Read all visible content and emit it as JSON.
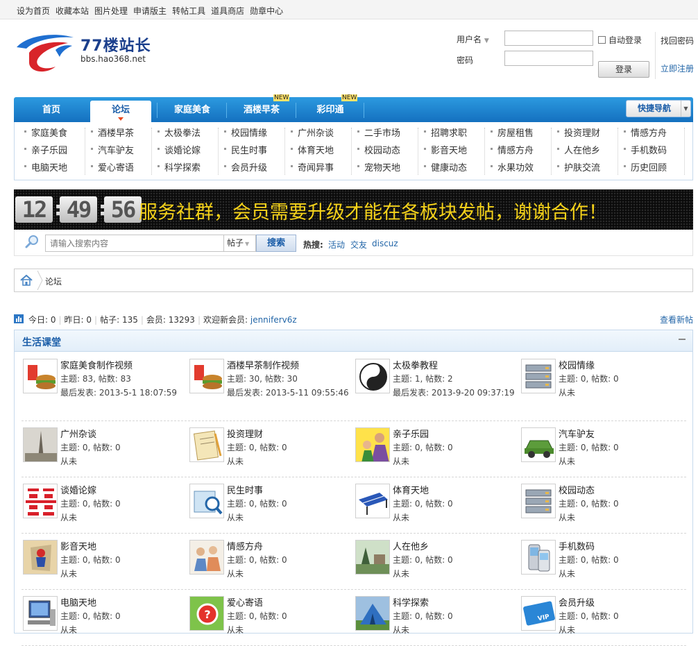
{
  "topbar": {
    "links": [
      "设为首页",
      "收藏本站",
      "图片处理",
      "申请版主",
      "转帖工具",
      "道具商店",
      "勋章中心"
    ]
  },
  "logo": {
    "brand": "77楼站长",
    "domain": "bbs.hao368.net"
  },
  "login": {
    "username_label": "用户名",
    "password_label": "密码",
    "auto_login": "自动登录",
    "login_button": "登录",
    "find_password": "找回密码",
    "register": "立即注册"
  },
  "nav": {
    "items": [
      {
        "label": "首页",
        "active": false
      },
      {
        "label": "论坛",
        "active": true
      },
      {
        "label": "家庭美食",
        "active": false
      },
      {
        "label": "酒楼早茶",
        "active": false,
        "badge": "NEW"
      },
      {
        "label": "彩印通",
        "active": false,
        "badge": "NEW"
      }
    ],
    "quick_nav": "快捷导航"
  },
  "subnav": {
    "columns": [
      [
        "家庭美食",
        "亲子乐园",
        "电脑天地"
      ],
      [
        "酒楼早茶",
        "汽车驴友",
        "爱心寄语"
      ],
      [
        "太极拳法",
        "谈婚论嫁",
        "科学探索"
      ],
      [
        "校园情缘",
        "民生时事",
        "会员升级"
      ],
      [
        "广州杂谈",
        "体育天地",
        "奇闻异事"
      ],
      [
        "二手市场",
        "校园动态",
        "宠物天地"
      ],
      [
        "招聘求职",
        "影音天地",
        "健康动态"
      ],
      [
        "房屋租售",
        "情感方舟",
        "水果功效"
      ],
      [
        "投资理财",
        "人在他乡",
        "护肤交流"
      ],
      [
        "情感方舟",
        "手机数码",
        "历史回顾"
      ]
    ]
  },
  "ticker": {
    "time": [
      "12",
      "49",
      "56"
    ],
    "message": "服务社群，会员需要升级才能在各板块发帖，谢谢合作！"
  },
  "search": {
    "placeholder": "请输入搜索内容",
    "type": "帖子",
    "button": "搜索",
    "hot_label": "热搜:",
    "hot": [
      "活动",
      "交友",
      "discuz"
    ]
  },
  "breadcrumb": {
    "current": "论坛"
  },
  "stats": {
    "today": "今日: 0",
    "yesterday": "昨日: 0",
    "posts": "帖子: 135",
    "members": "会员: 13293",
    "welcome": "欢迎新会员: ",
    "new_member": "jenniferv6z",
    "view_new": "查看新帖"
  },
  "forum": {
    "category": "生活课堂",
    "rows": [
      [
        {
          "name": "家庭美食制作视频",
          "stats": "主题: 83, 帖数: 83",
          "last": "最后发表: 2013-5-1 18:07:59",
          "icon": "food-icon"
        },
        {
          "name": "酒楼早茶制作视频",
          "stats": "主题: 30, 帖数: 30",
          "last": "最后发表: 2013-5-11 09:55:46",
          "icon": "food-icon"
        },
        {
          "name": "太极拳教程",
          "stats": "主题: 1, 帖数: 2",
          "last": "最后发表: 2013-9-20 09:37:19",
          "icon": "taichi-icon"
        },
        {
          "name": "校园情缘",
          "stats": "主题: 0, 帖数: 0",
          "last": "从未",
          "icon": "server-icon"
        }
      ],
      [
        {
          "name": "广州杂谈",
          "stats": "主题: 0, 帖数: 0",
          "last": "从未",
          "icon": "tower-icon"
        },
        {
          "name": "投资理财",
          "stats": "主题: 0, 帖数: 0",
          "last": "从未",
          "icon": "notepad-icon"
        },
        {
          "name": "亲子乐园",
          "stats": "主题: 0, 帖数: 0",
          "last": "从未",
          "icon": "family-icon"
        },
        {
          "name": "汽车驴友",
          "stats": "主题: 0, 帖数: 0",
          "last": "从未",
          "icon": "car-icon"
        }
      ],
      [
        {
          "name": "谈婚论嫁",
          "stats": "主题: 0, 帖数: 0",
          "last": "从未",
          "icon": "double-happiness-icon"
        },
        {
          "name": "民生时事",
          "stats": "主题: 0, 帖数: 0",
          "last": "从未",
          "icon": "map-search-icon"
        },
        {
          "name": "体育天地",
          "stats": "主题: 0, 帖数: 0",
          "last": "从未",
          "icon": "pingpong-table-icon"
        },
        {
          "name": "校园动态",
          "stats": "主题: 0, 帖数: 0",
          "last": "从未",
          "icon": "server-icon"
        }
      ],
      [
        {
          "name": "影音天地",
          "stats": "主题: 0, 帖数: 0",
          "last": "从未",
          "icon": "spiderman-icon"
        },
        {
          "name": "情感方舟",
          "stats": "主题: 0, 帖数: 0",
          "last": "从未",
          "icon": "people-icon"
        },
        {
          "name": "人在他乡",
          "stats": "主题: 0, 帖数: 0",
          "last": "从未",
          "icon": "landscape-icon"
        },
        {
          "name": "手机数码",
          "stats": "主题: 0, 帖数: 0",
          "last": "从未",
          "icon": "phone-icon"
        }
      ],
      [
        {
          "name": "电脑天地",
          "stats": "主题: 0, 帖数: 0",
          "last": "从未",
          "icon": "computer-icon"
        },
        {
          "name": "爱心寄语",
          "stats": "主题: 0, 帖数: 0",
          "last": "从未",
          "icon": "help-compass-icon"
        },
        {
          "name": "科学探索",
          "stats": "主题: 0, 帖数: 0",
          "last": "从未",
          "icon": "tent-icon"
        },
        {
          "name": "会员升级",
          "stats": "主题: 0, 帖数: 0",
          "last": "从未",
          "icon": "vip-card-icon"
        }
      ]
    ]
  }
}
